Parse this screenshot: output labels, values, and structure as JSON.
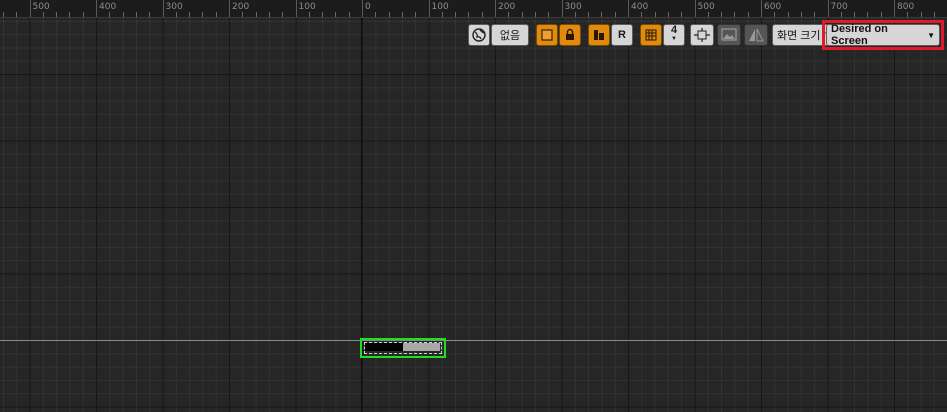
{
  "ruler": {
    "labels": [
      "500",
      "400",
      "300",
      "200",
      "100",
      "0",
      "100",
      "200",
      "300",
      "400",
      "500",
      "600",
      "700",
      "800"
    ]
  },
  "toolbar": {
    "locale_icon": "globe-icon",
    "none_label": "없음",
    "r_label": "R",
    "grid_snap_value": "4",
    "screen_size_label": "화면 크기",
    "desired_on_screen_label": "Desired on Screen"
  },
  "widget": {
    "progress_fraction": 0.5
  },
  "colors": {
    "accent_orange": "#e08a10",
    "selection_green": "#1ee01e",
    "highlight_red": "#e0192b"
  }
}
